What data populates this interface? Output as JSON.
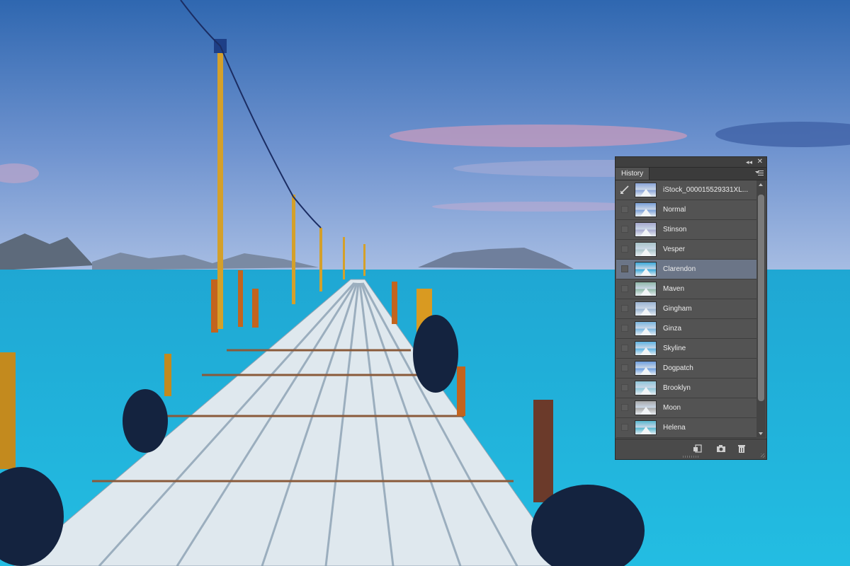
{
  "panel": {
    "tab_label": "History",
    "collapse_glyph": "◂◂",
    "close_glyph": "✕"
  },
  "history": {
    "items": [
      {
        "label": "iStock_000015529331XL...",
        "kind": "snapshot",
        "tint": "#8aa4d8"
      },
      {
        "label": "Normal",
        "kind": "state",
        "tint": "#7aa0d8"
      },
      {
        "label": "Stinson",
        "kind": "state",
        "tint": "#a6a9cf"
      },
      {
        "label": "Vesper",
        "kind": "state",
        "tint": "#a9c4c9"
      },
      {
        "label": "Clarendon",
        "kind": "state",
        "tint": "#3aa9da"
      },
      {
        "label": "Maven",
        "kind": "state",
        "tint": "#90b8a8"
      },
      {
        "label": "Gingham",
        "kind": "state",
        "tint": "#9bb5d3"
      },
      {
        "label": "Ginza",
        "kind": "state",
        "tint": "#7ab7e0"
      },
      {
        "label": "Skyline",
        "kind": "state",
        "tint": "#5fb4e3"
      },
      {
        "label": "Dogpatch",
        "kind": "state",
        "tint": "#6e9fe0"
      },
      {
        "label": "Brooklyn",
        "kind": "state",
        "tint": "#8fc6d9"
      },
      {
        "label": "Moon",
        "kind": "state",
        "tint": "#a9a9a9"
      },
      {
        "label": "Helena",
        "kind": "state",
        "tint": "#58b8d0"
      }
    ],
    "selected": "Clarendon"
  },
  "footer_icons": [
    "new-document-from-state-icon",
    "camera-icon",
    "trash-icon"
  ],
  "colors": {
    "panel_bg": "#535353",
    "selected_row": "#6b7587",
    "sky_top": "#2f6fb6",
    "sea": "#21b3da"
  }
}
